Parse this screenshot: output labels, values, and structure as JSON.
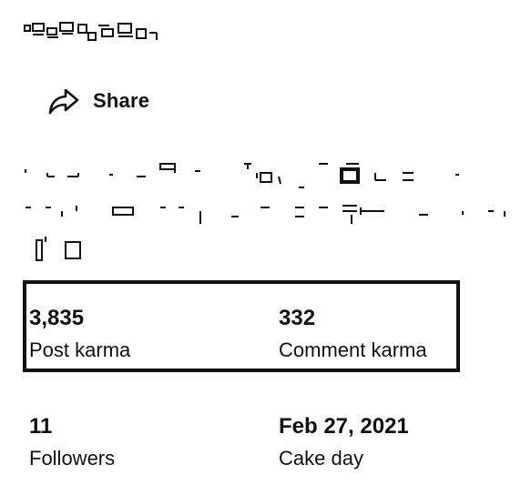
{
  "share": {
    "label": "Share",
    "icon": "share-icon"
  },
  "stats": {
    "post_karma": {
      "value": "3,835",
      "label": "Post karma"
    },
    "comment_karma": {
      "value": "332",
      "label": "Comment karma"
    },
    "followers": {
      "value": "11",
      "label": "Followers"
    },
    "cake_day": {
      "value": "Feb 27, 2021",
      "label": "Cake day"
    }
  }
}
